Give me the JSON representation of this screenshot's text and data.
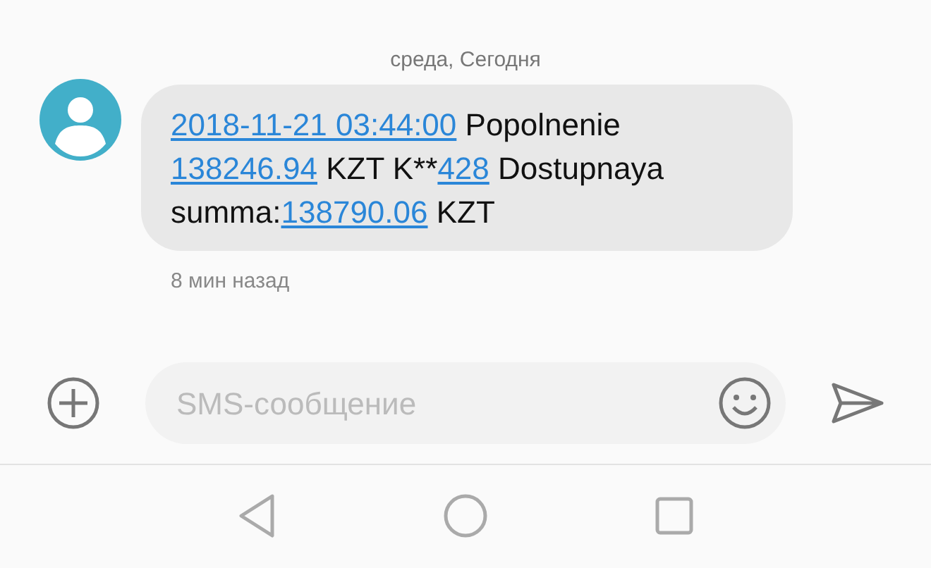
{
  "date_header": "среда, Сегодня",
  "message": {
    "segments": [
      {
        "kind": "link",
        "text": "2018-11-21 03:44:00"
      },
      {
        "kind": "text",
        "text": " Popolnenie "
      },
      {
        "kind": "link",
        "text": "138246.94"
      },
      {
        "kind": "text",
        "text": " KZT K**"
      },
      {
        "kind": "link",
        "text": "428"
      },
      {
        "kind": "text",
        "text": " Dostupnaya summa:"
      },
      {
        "kind": "link",
        "text": "138790.06"
      },
      {
        "kind": "text",
        "text": " KZT"
      }
    ],
    "time": "8 мин назад"
  },
  "composer": {
    "placeholder": "SMS-сообщение"
  }
}
